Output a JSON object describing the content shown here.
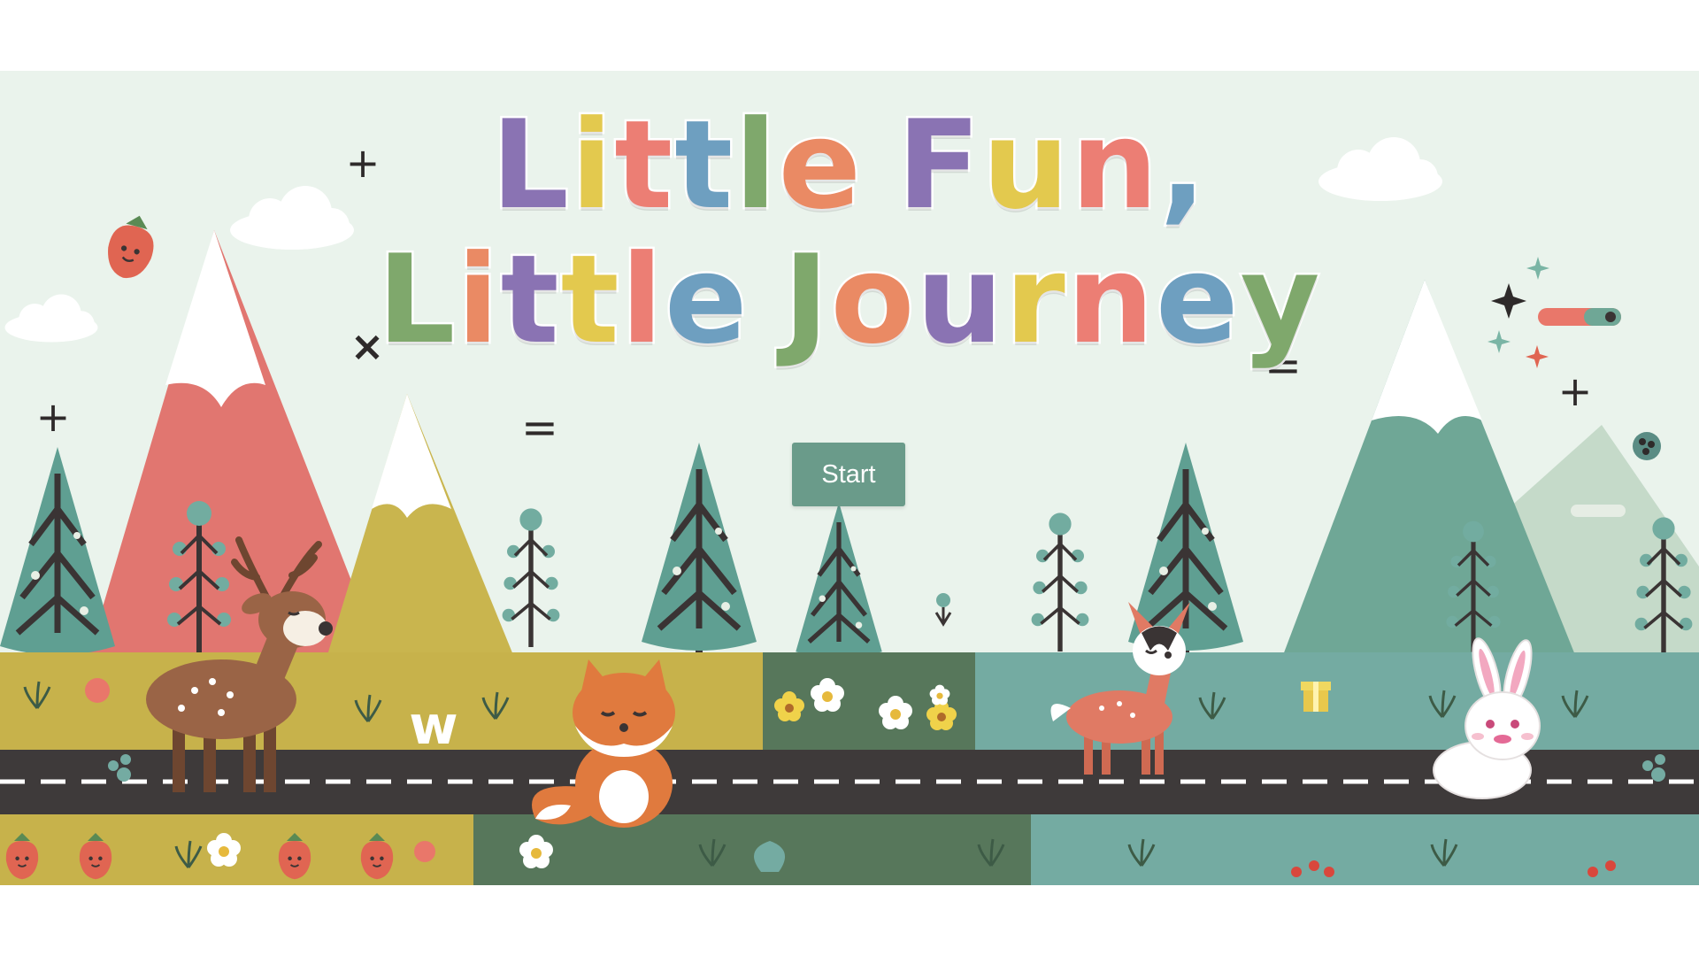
{
  "game": {
    "title_line_1": "Little Fun,",
    "title_line_2": "Little Journey",
    "title_palette": [
      "#8a73b3",
      "#e3c94e",
      "#ec7e74",
      "#6e9fc0",
      "#7fa86c",
      "#ea8a64"
    ],
    "start_label": "Start"
  },
  "colors": {
    "sky": "#eaf3ec",
    "red_mountain": "#e17670",
    "yellow_mountain": "#c9b54e",
    "teal_mountain": "#6fa796",
    "pale_mountain": "#c5dac9",
    "tree": "#5f9f92",
    "trunk": "#3a3434",
    "meadow_yellow": "#c7b24b",
    "meadow_dark": "#57775b",
    "meadow_teal": "#74aba2",
    "road": "#3e3a3a",
    "button": "#6a9b8a"
  },
  "icons": [
    "plus-icon",
    "times-icon",
    "equals-icon",
    "sparkle-icon",
    "cloud-icon",
    "strawberry-icon",
    "flower-icon",
    "deer-icon",
    "fox-icon",
    "fawn-icon",
    "bunny-icon",
    "tree-icon"
  ]
}
